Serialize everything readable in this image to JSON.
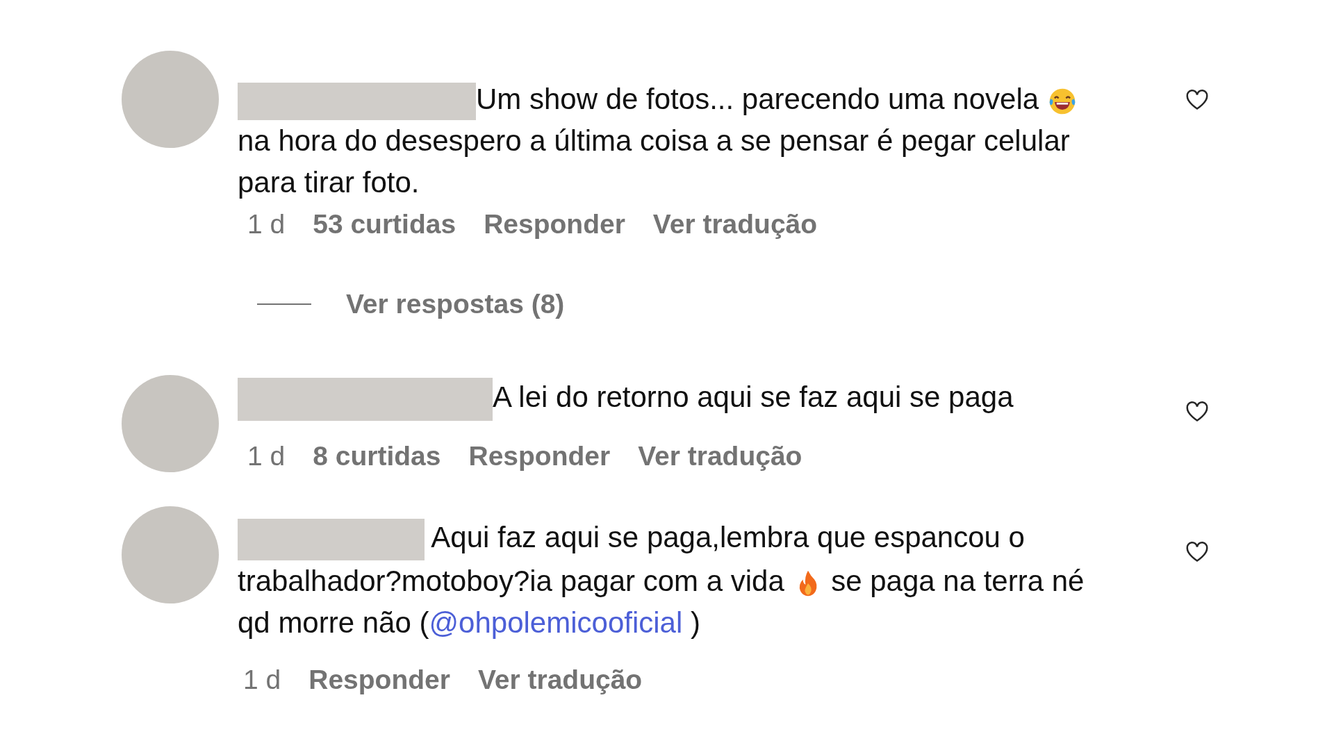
{
  "comments": [
    {
      "author_hidden": true,
      "liked": false,
      "content": [
        {
          "kind": "text",
          "text": "Um show de fotos... parecendo uma novela "
        },
        {
          "kind": "laugh"
        },
        {
          "kind": "text",
          "text": " na hora do desespero a última coisa a se pensar é pegar celular para tirar foto."
        }
      ],
      "meta": {
        "time": "1 d",
        "likes": "53 curtidas",
        "reply": "Responder",
        "translate": "Ver tradução"
      },
      "replies": {
        "label": "Ver respostas (8)"
      }
    },
    {
      "author_hidden": true,
      "liked": false,
      "content": [
        {
          "kind": "text",
          "text": "A lei do retorno aqui se faz aqui se paga"
        }
      ],
      "meta": {
        "time": "1 d",
        "likes": "8 curtidas",
        "reply": "Responder",
        "translate": "Ver tradução"
      }
    },
    {
      "author_hidden": true,
      "liked": false,
      "content": [
        {
          "kind": "text",
          "text": " Aqui faz aqui se paga,lembra que espancou o trabalhador?motoboy?ia pagar com a vida "
        },
        {
          "kind": "fire"
        },
        {
          "kind": "text",
          "text": " se paga na terra né qd morre não ("
        },
        {
          "kind": "mention",
          "text": "@ohpolemicooficial"
        },
        {
          "kind": "text",
          "text": " )"
        }
      ],
      "meta": {
        "time": "1 d",
        "reply": "Responder",
        "translate": "Ver tradução"
      }
    }
  ]
}
